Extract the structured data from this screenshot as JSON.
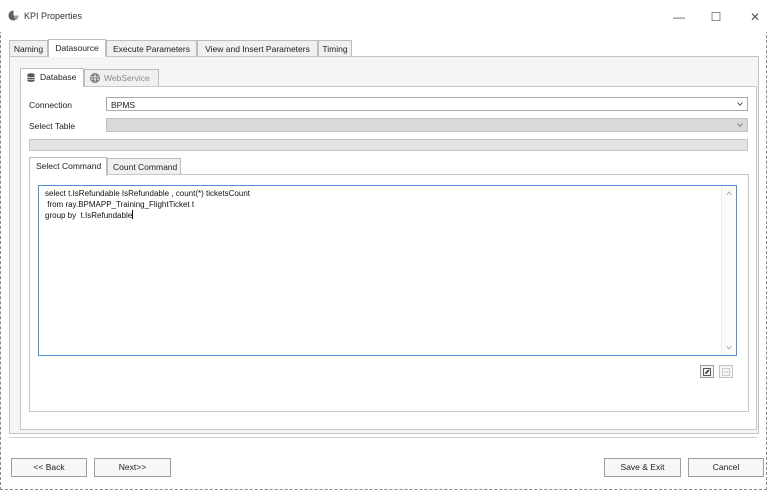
{
  "window": {
    "title": "KPI Properties",
    "minimize_glyph": "—",
    "maximize_glyph": "☐",
    "close_glyph": "✕"
  },
  "main_tabs": [
    {
      "label": "Naming"
    },
    {
      "label": "Datasource"
    },
    {
      "label": "Execute Parameters"
    },
    {
      "label": "View and Insert Parameters"
    },
    {
      "label": "Timing"
    }
  ],
  "datasource_tabs": [
    {
      "label": "Database",
      "icon": "database-icon"
    },
    {
      "label": "WebService",
      "icon": "globe-icon"
    }
  ],
  "form": {
    "connection_label": "Connection",
    "connection_value": "BPMS",
    "select_table_label": "Select Table",
    "select_table_value": ""
  },
  "command_tabs": [
    {
      "label": "Select Command"
    },
    {
      "label": "Count Command"
    }
  ],
  "editor": {
    "lines": [
      "select t.IsRefundable IsRefundable , count(*) ticketsCount",
      " from ray.BPMAPP_Training_FlightTicket t",
      "group by  t.IsRefundable"
    ]
  },
  "footer": {
    "back_label": "<< Back",
    "next_label": "Next>>",
    "save_exit_label": "Save & Exit",
    "cancel_label": "Cancel"
  },
  "colors": {
    "editor_border": "#4e8fd1",
    "disabled_fill": "#d9d9d9"
  }
}
